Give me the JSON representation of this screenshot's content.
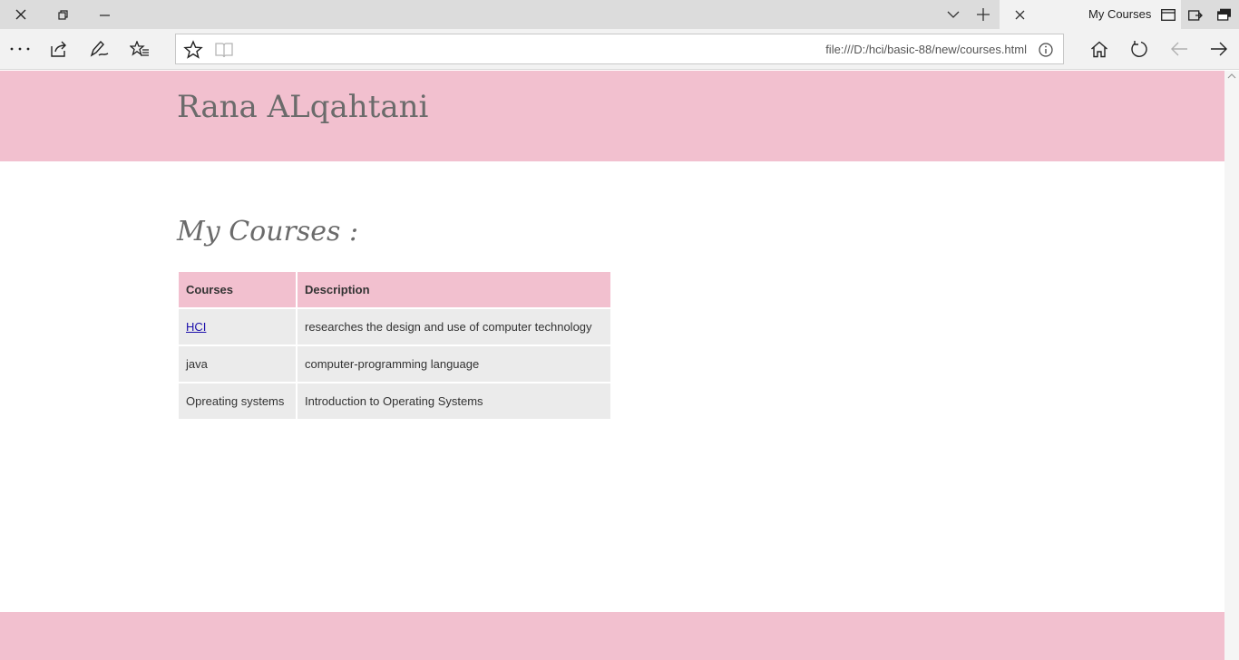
{
  "browser": {
    "tab_title": "My Courses",
    "url": "file:///D:/hci/basic-88/new/courses.html"
  },
  "page": {
    "site_name": "Rana ALqahtani",
    "section_title": "My Courses :",
    "table": {
      "headers": [
        "Courses",
        "Description"
      ],
      "rows": [
        {
          "course": "HCI",
          "description": "researches the design and use of computer technology",
          "is_link": true
        },
        {
          "course": "java",
          "description": "computer-programming language",
          "is_link": false
        },
        {
          "course": "Opreating systems",
          "description": "Introduction to Operating Systems",
          "is_link": false
        }
      ]
    }
  },
  "colors": {
    "header_pink": "#f2c0cf",
    "cell_gray": "#ebebeb",
    "link_blue": "#1a0dab"
  },
  "icons": {
    "titlebar": [
      "close-window-icon",
      "restore-icon",
      "minimize-icon",
      "tab-list-chevron-icon",
      "new-tab-plus-icon",
      "close-tab-icon",
      "tab-preview-icon",
      "set-aside-tabs-icon",
      "tabs-aside-icon"
    ],
    "toolbar": [
      "more-icon",
      "share-icon",
      "web-note-icon",
      "favorites-hub-icon",
      "favorite-star-icon",
      "reading-view-icon",
      "site-info-icon",
      "home-icon",
      "refresh-icon",
      "back-arrow-icon",
      "forward-arrow-icon"
    ]
  }
}
